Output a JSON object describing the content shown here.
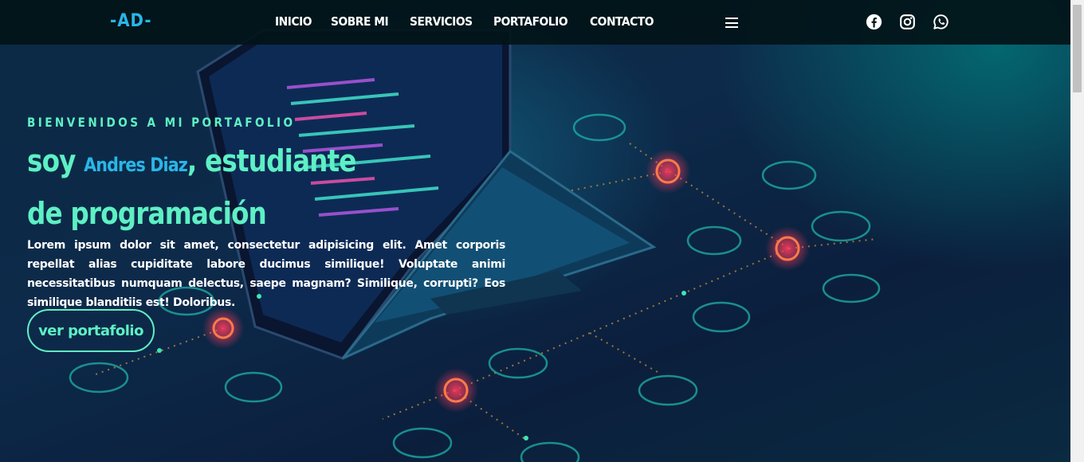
{
  "nav": {
    "logo": "-AD-",
    "links": [
      "INICIO",
      "SOBRE MI",
      "SERVICIOS",
      "PORTAFOLIO",
      "CONTACTO"
    ],
    "social_icons": [
      "facebook-icon",
      "instagram-icon",
      "whatsapp-icon"
    ]
  },
  "hero": {
    "kicker": "BIENVENIDOS A MI PORTAFOLIO",
    "headline_prefix": "soy ",
    "name": "Andres Diaz",
    "headline_suffix": ", estudiante de programación",
    "description": "Lorem ipsum dolor sit amet, consectetur adipisicing elit. Amet corporis repellat alias cupiditate labore ducimus similique! Voluptate animi necessitatibus numquam delectus, saepe magnam? Similique, corrupti? Eos similique blanditiis est! Doloribus.",
    "button": "ver portafolio"
  },
  "colors": {
    "accent": "#5ef0c4",
    "name_blue": "#29b6e8",
    "nav_bg": "#021418"
  }
}
